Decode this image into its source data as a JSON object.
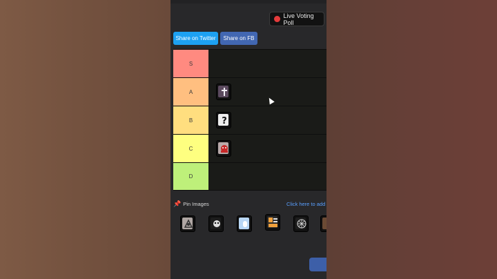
{
  "header": {
    "live_poll_label": "Live Voting Poll",
    "share_twitter_label": "Share on Twitter",
    "share_fb_label": "Share on FB"
  },
  "tiers": [
    {
      "label": "S",
      "color": "#ff8a80"
    },
    {
      "label": "A",
      "color": "#ffbf80"
    },
    {
      "label": "B",
      "color": "#ffde7f"
    },
    {
      "label": "C",
      "color": "#feff80"
    },
    {
      "label": "D",
      "color": "#bef07a"
    }
  ],
  "tier_items": {
    "A": [
      "cross-tombstone-card"
    ],
    "B": [
      "question-mark-card"
    ],
    "C": [
      "red-creature-card"
    ]
  },
  "pin_images": {
    "label": "Pin Images",
    "pin_icon": "pushpin-icon",
    "link_text": "Click here to add"
  },
  "pool_items": [
    "skull-sigil-card",
    "black-skull-card",
    "blue-ghost-card",
    "sit-jump-card",
    "dark-web-card",
    "brown-card-partial"
  ]
}
